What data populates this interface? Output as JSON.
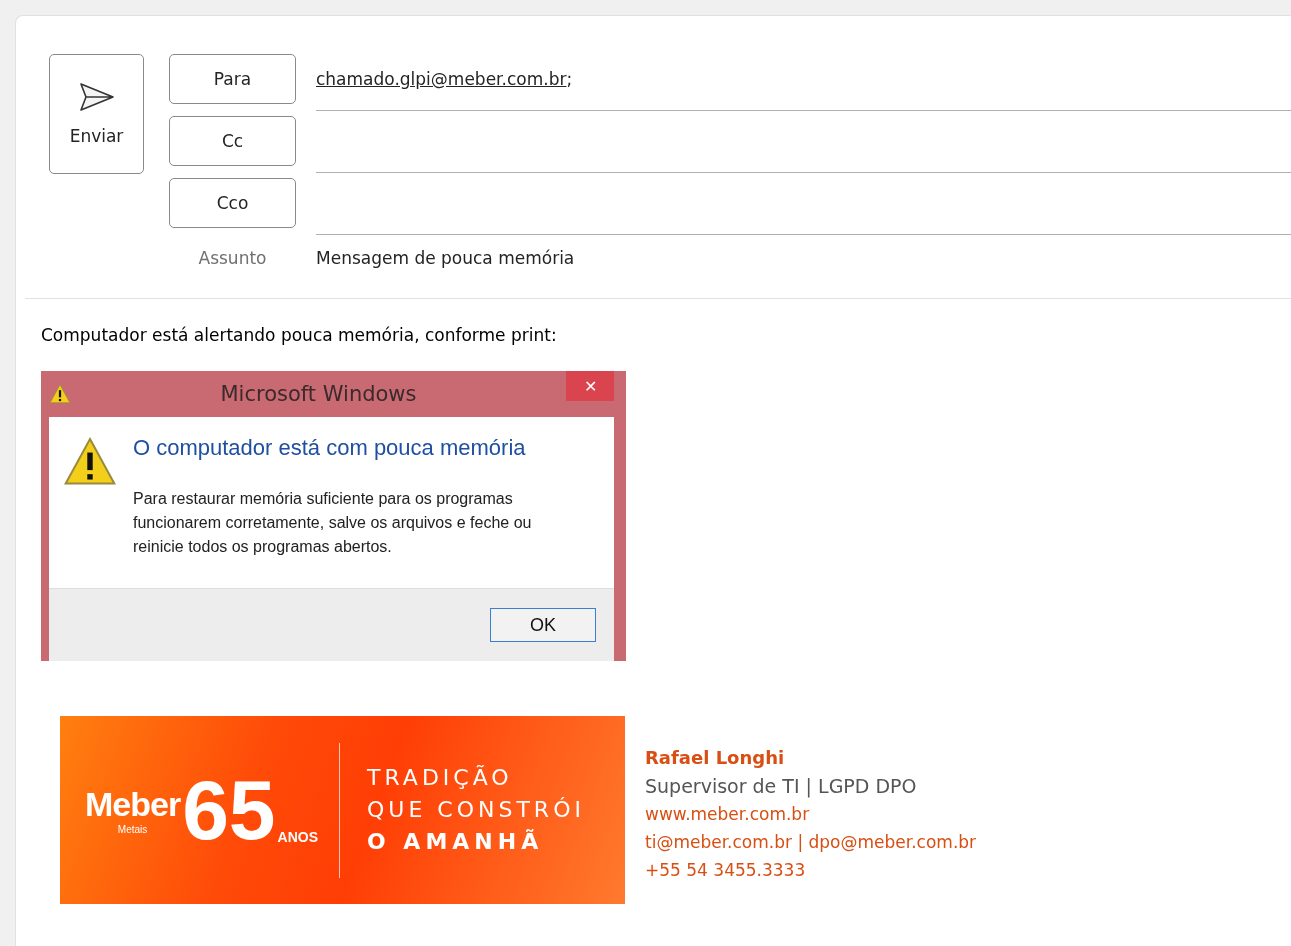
{
  "compose": {
    "send_button": "Enviar",
    "recipients": [
      {
        "label": "Para",
        "value": "chamado.glpi@meber.com.br",
        "separator": ";"
      },
      {
        "label": "Cc"
      },
      {
        "label": "Cco"
      }
    ],
    "subject_label": "Assunto",
    "subject": "Mensagem de pouca memória"
  },
  "body": {
    "intro": "Computador está alertando pouca memória, conforme print:",
    "dialog": {
      "title": "Microsoft Windows",
      "close": "✕",
      "heading": "O computador está com pouca memória",
      "message": "Para restaurar memória suficiente para os programas funcionarem corretamente, salve os arquivos e feche ou reinicie todos os programas abertos.",
      "button": "OK"
    },
    "signature": {
      "banner": {
        "brand": "Meber",
        "sub": "Metais",
        "number": "65",
        "anos": "ANOS",
        "tagline": [
          "TRADIÇÃO",
          "QUE CONSTRÓI"
        ],
        "tagline_bold": "O AMANHÃ"
      },
      "name": "Rafael Longhi",
      "role": "Supervisor de TI | LGPD DPO",
      "website": "www.meber.com.br",
      "emails": "ti@meber.com.br | dpo@meber.com.br",
      "phone": "+55 54 3455.3333"
    }
  }
}
